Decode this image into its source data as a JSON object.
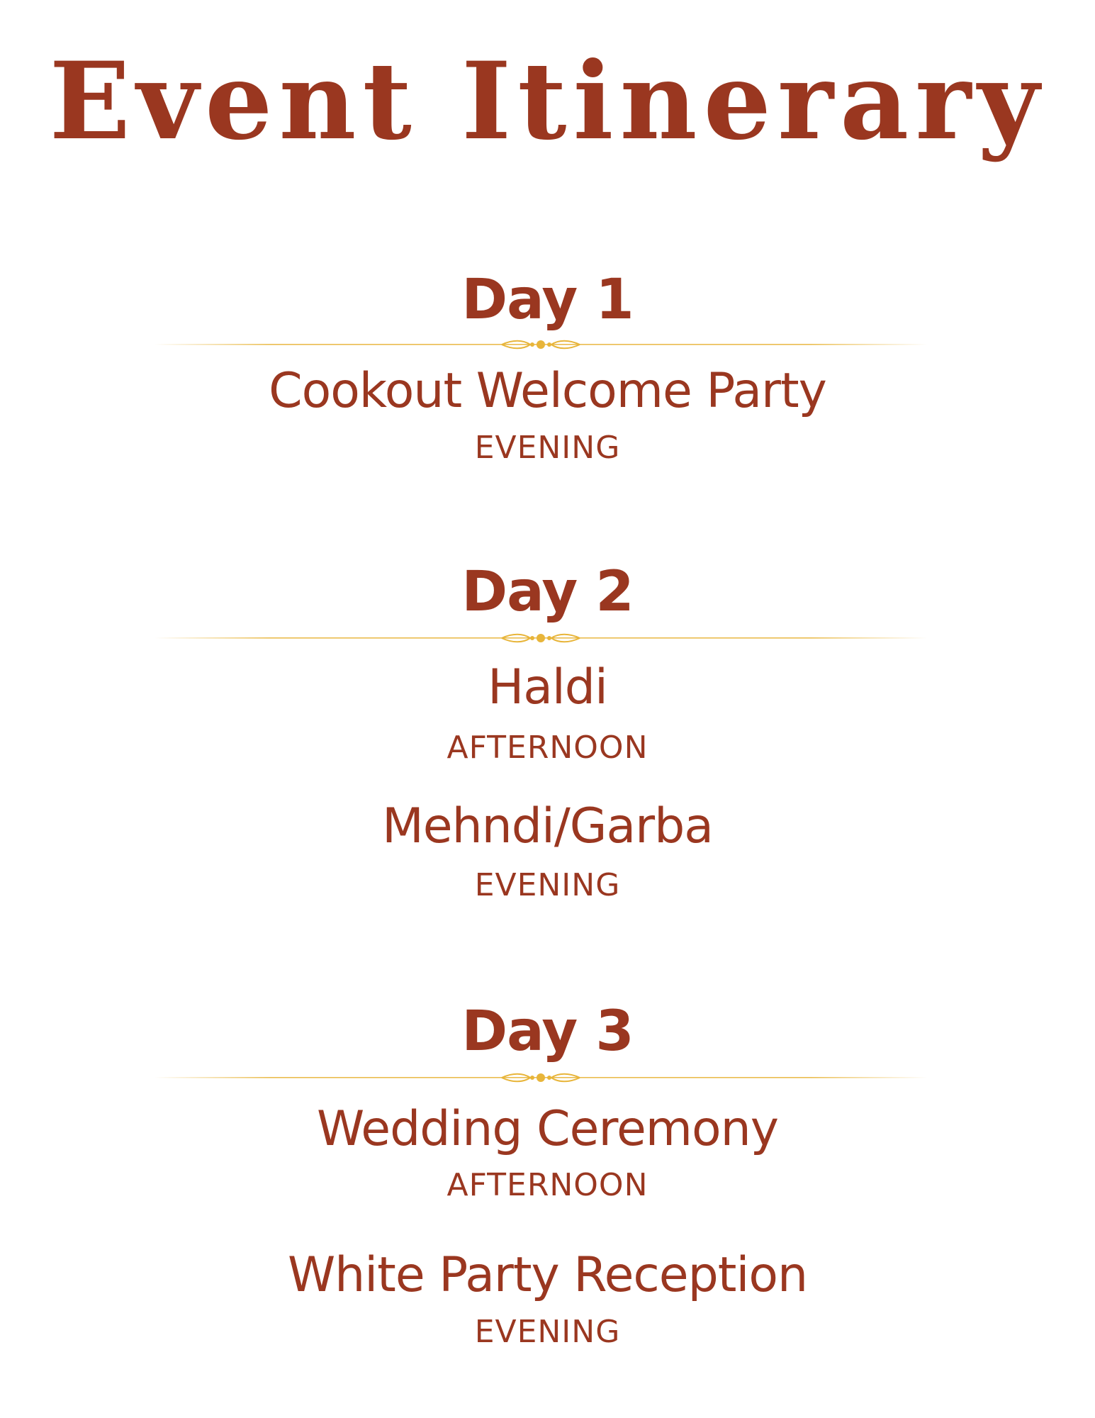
{
  "title": "Event Itinerary",
  "colors": {
    "text": "#9a3720",
    "divider": "#e8b53a"
  },
  "days": [
    {
      "heading": "Day 1",
      "events": [
        {
          "name": "Cookout Welcome Party",
          "time": "EVENING"
        }
      ]
    },
    {
      "heading": "Day 2",
      "events": [
        {
          "name": "Haldi",
          "time": "AFTERNOON"
        },
        {
          "name": "Mehndi/Garba",
          "time": "EVENING"
        }
      ]
    },
    {
      "heading": "Day 3",
      "events": [
        {
          "name": "Wedding Ceremony",
          "time": "AFTERNOON"
        },
        {
          "name": "White Party Reception",
          "time": "EVENING"
        }
      ]
    }
  ]
}
